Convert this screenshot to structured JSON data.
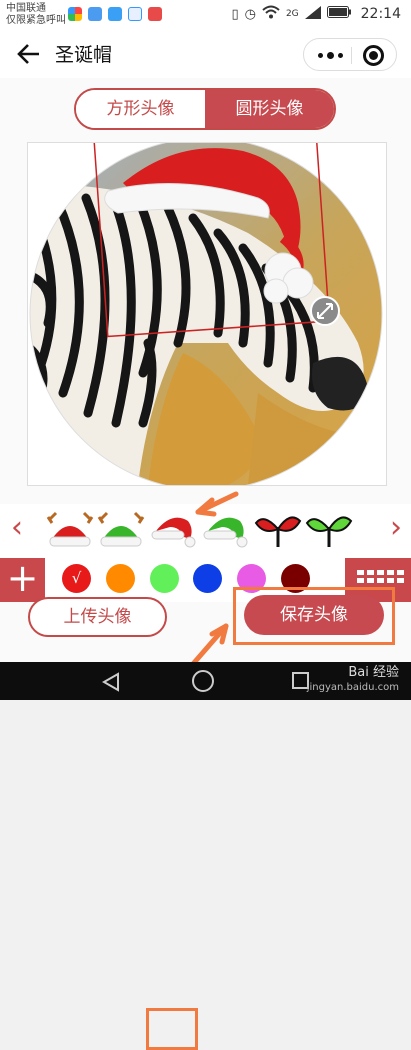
{
  "statusbar": {
    "carrier_line1": "中国联通",
    "carrier_line2": "仅限紧急呼叫",
    "network": "2G",
    "battery_icon": "battery-icon",
    "time": "22:14"
  },
  "navbar": {
    "title": "圣诞帽",
    "back_icon": "arrow-left-icon",
    "more_icon": "more-dots-icon",
    "close_icon": "target-icon"
  },
  "tabs": [
    {
      "label": "方形头像",
      "active": false
    },
    {
      "label": "圆形头像",
      "active": true
    }
  ],
  "editor": {
    "photo": "zebra",
    "overlay": "santa-hat",
    "handle_icon": "resize-handle-icon"
  },
  "hats": {
    "left_arrow": "‹",
    "right_arrow": "›",
    "items": [
      "red-reindeer-hat",
      "green-reindeer-hat",
      "red-santa-hat",
      "green-santa-hat",
      "red-sprout",
      "green-sprout"
    ],
    "selected_index": 2
  },
  "palette": {
    "plus_icon": "plus-icon",
    "keyboard_icon": "keyboard-icon",
    "check": "√",
    "colors": [
      "#e81919",
      "#ff8a00",
      "#62f05a",
      "#0e3fe6",
      "#e85be5",
      "#7a0000"
    ],
    "selected_index": 0
  },
  "actions": {
    "upload_label": "上传头像",
    "save_label": "保存头像"
  },
  "watermark": {
    "brand": "Bai 经验",
    "url": "jingyan.baidu.com"
  },
  "accent": "#c64a4f",
  "annotation_color": "#f07a3f"
}
